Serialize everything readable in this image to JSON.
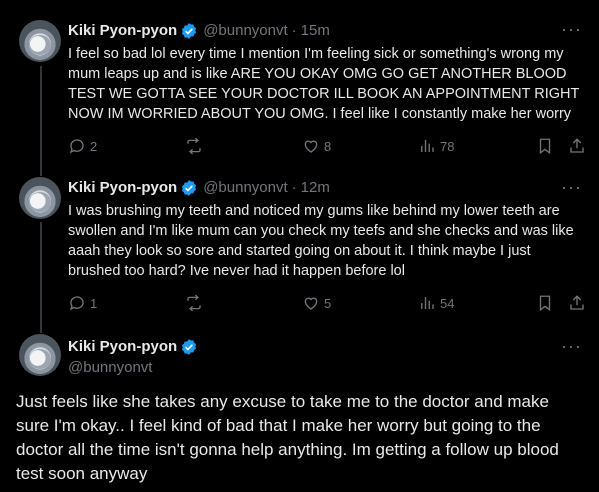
{
  "tweets": [
    {
      "name": "Kiki Pyon-pyon",
      "handle": "@bunnyonvt",
      "dot": "·",
      "time": "15m",
      "text": "I feel so bad lol every time I mention I'm feeling sick or something's wrong my mum leaps up and is like ARE YOU OKAY OMG GO GET ANOTHER BLOOD TEST WE GOTTA SEE YOUR DOCTOR ILL BOOK AN APPOINTMENT RIGHT NOW IM WORRIED ABOUT YOU OMG. I feel like I constantly make her worry",
      "replies": "2",
      "retweets": "",
      "likes": "8",
      "views": "78"
    },
    {
      "name": "Kiki Pyon-pyon",
      "handle": "@bunnyonvt",
      "dot": "·",
      "time": "12m",
      "text": "I was brushing my teeth and noticed my gums like behind my lower teeth are swollen and I'm like mum can you check my teefs and she checks and was like aaah they look so sore and started going on about it. I think maybe I just brushed too hard? Ive never had it happen before lol",
      "replies": "1",
      "retweets": "",
      "likes": "5",
      "views": "54"
    }
  ],
  "main_tweet": {
    "name": "Kiki Pyon-pyon",
    "handle": "@bunnyonvt",
    "text": "Just feels like she takes any excuse to take me to the doctor and make sure I'm okay.. I feel kind of bad that I make her worry but going to the doctor all the time isn't gonna help anything. Im getting a follow up blood test soon anyway"
  },
  "more_glyph": "···",
  "icons": {
    "reply": "speech-bubble-icon",
    "retweet": "retweet-icon",
    "like": "heart-icon",
    "views": "bar-chart-icon",
    "bookmark": "bookmark-icon",
    "share": "share-icon",
    "verified": "verified-badge-icon",
    "more": "more-horizontal-icon"
  },
  "colors": {
    "background": "#000000",
    "text": "#e7e9ea",
    "muted": "#71767b",
    "verified": "#1d9bf0",
    "thread_line": "#333639"
  }
}
